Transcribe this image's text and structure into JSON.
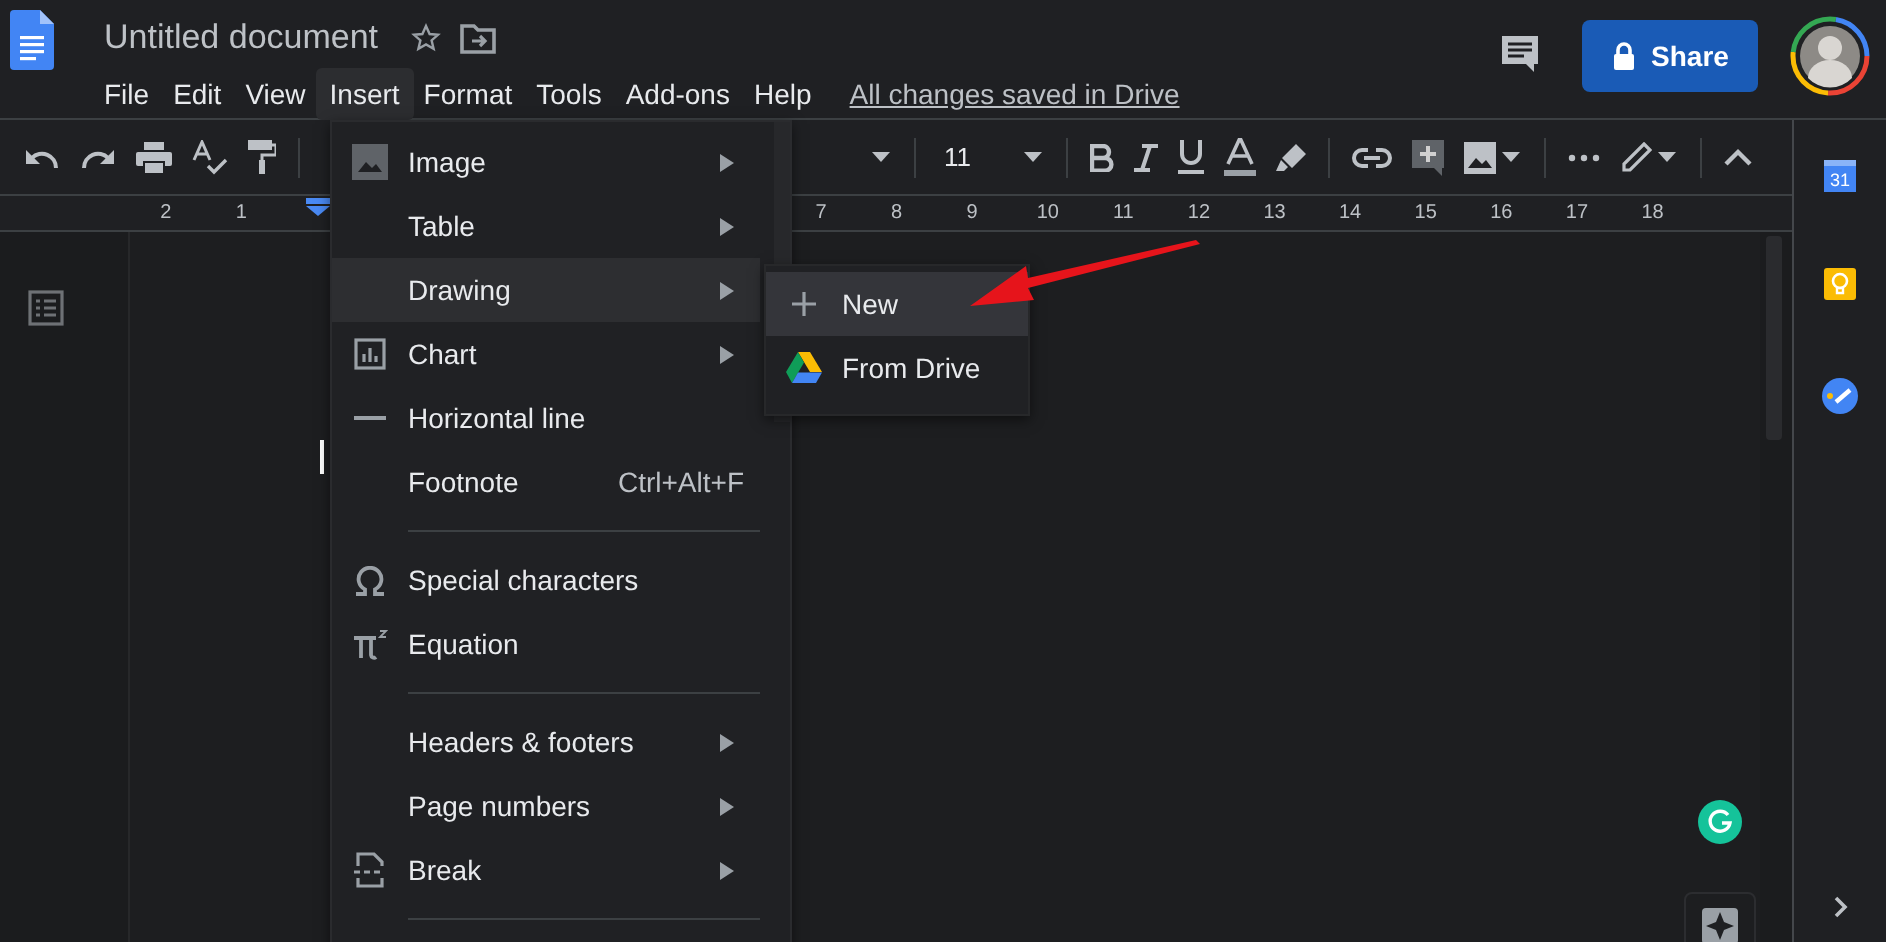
{
  "app": {
    "doc_title": "Untitled document",
    "save_status": "All changes saved in Drive",
    "share_label": "Share"
  },
  "menu_bar": [
    {
      "label": "File",
      "selected": false
    },
    {
      "label": "Edit",
      "selected": false
    },
    {
      "label": "View",
      "selected": false
    },
    {
      "label": "Insert",
      "selected": true
    },
    {
      "label": "Format",
      "selected": false
    },
    {
      "label": "Tools",
      "selected": false
    },
    {
      "label": "Add-ons",
      "selected": false
    },
    {
      "label": "Help",
      "selected": false
    }
  ],
  "toolbar": {
    "font_size": "11"
  },
  "ruler": {
    "left_labels": [
      "2",
      "1"
    ],
    "right_labels": [
      "7",
      "8",
      "9",
      "10",
      "11",
      "12",
      "13",
      "14",
      "15",
      "16",
      "17",
      "18"
    ]
  },
  "insert_menu": {
    "groups": [
      [
        {
          "kind": "image",
          "label": "Image",
          "submenu": true,
          "selected": false
        },
        {
          "kind": "table",
          "label": "Table",
          "submenu": true,
          "selected": false
        },
        {
          "kind": "drawing",
          "label": "Drawing",
          "submenu": true,
          "selected": true
        },
        {
          "kind": "chart",
          "label": "Chart",
          "submenu": true,
          "selected": false
        },
        {
          "kind": "line",
          "label": "Horizontal line",
          "submenu": false,
          "selected": false
        },
        {
          "kind": "footnote",
          "label": "Footnote",
          "shortcut": "Ctrl+Alt+F",
          "submenu": false,
          "selected": false
        }
      ],
      [
        {
          "kind": "omega",
          "label": "Special characters",
          "submenu": false,
          "selected": false
        },
        {
          "kind": "equation",
          "label": "Equation",
          "submenu": false,
          "selected": false
        }
      ],
      [
        {
          "kind": "headers",
          "label": "Headers & footers",
          "submenu": true,
          "selected": false
        },
        {
          "kind": "pages",
          "label": "Page numbers",
          "submenu": true,
          "selected": false
        },
        {
          "kind": "break",
          "label": "Break",
          "submenu": true,
          "selected": false
        }
      ]
    ]
  },
  "drawing_submenu": [
    {
      "kind": "plus",
      "label": "New",
      "selected": true
    },
    {
      "kind": "drive",
      "label": "From Drive",
      "selected": false
    }
  ],
  "side_panel": {
    "calendar_day": "31"
  }
}
